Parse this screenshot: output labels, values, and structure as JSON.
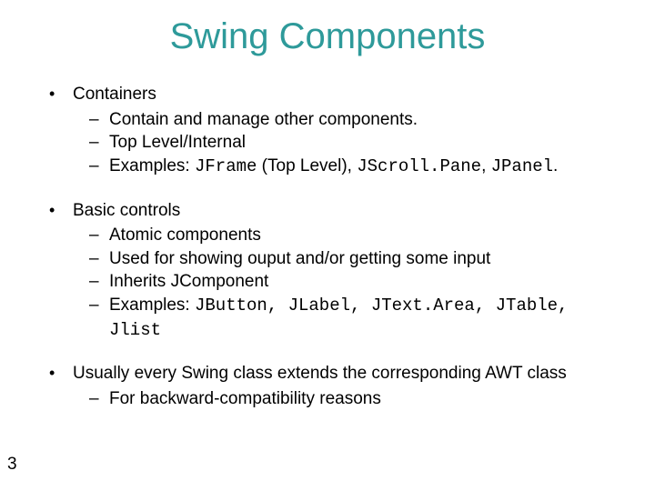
{
  "title": "Swing Components",
  "bullets": {
    "b1": {
      "head": "Containers",
      "i1": "Contain and manage other components.",
      "i2": "Top Level/Internal",
      "i3_pre": "Examples: ",
      "i3_code1": "JFrame",
      "i3_mid1": " (Top Level), ",
      "i3_code2": "JScroll.Pane",
      "i3_mid2": ", ",
      "i3_code3": "JPanel",
      "i3_tail": "."
    },
    "b2": {
      "head": "Basic controls",
      "i1": "Atomic components",
      "i2": "Used for showing ouput and/or getting some input",
      "i3": "Inherits JComponent",
      "i4_pre": "Examples: ",
      "i4_code1": "JButton, JLabel, JText.Area, JTable, Jlist"
    },
    "b3": {
      "head": "Usually every Swing class extends the corresponding AWT class",
      "i1": "For backward-compatibility reasons"
    }
  },
  "page_number": "3"
}
